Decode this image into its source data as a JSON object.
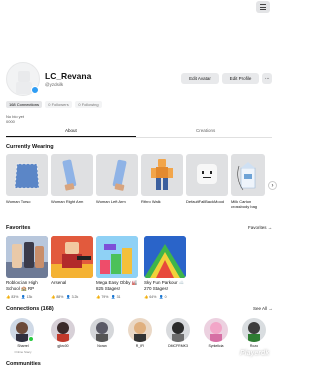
{
  "header": {
    "menu_icon": "hamburger-icon"
  },
  "profile": {
    "display_name": "LC_Revana",
    "username": "@yzdsilk",
    "edit_avatar_label": "Edit Avatar",
    "edit_profile_label": "Edit Profile",
    "more_label": "···",
    "status_color": "#2f9df4"
  },
  "stats": {
    "connections": "168 Connections",
    "followers": "0 Followers",
    "following": "0 Following"
  },
  "bio": {
    "line1": "No bio yet",
    "line2": "0000"
  },
  "tabs": [
    {
      "label": "About"
    },
    {
      "label": "Creations"
    }
  ],
  "currently_wearing": {
    "title": "Currently Wearing",
    "items": [
      {
        "label": "Woman Torso"
      },
      {
        "label": "Woman Right Arm"
      },
      {
        "label": "Woman Left Arm"
      },
      {
        "label": "Rthro Walk"
      },
      {
        "label": "DefaultFallBackMood"
      },
      {
        "label": "Milk Carton\ncrossbody bag"
      }
    ],
    "next_icon": "chevron-right-icon"
  },
  "favorites": {
    "title": "Favorites",
    "link_label": "Favorites →",
    "games": [
      {
        "title": "Roblox:ian High School 🏫 RP",
        "rating": "83%",
        "players": "13k"
      },
      {
        "title": "Arsenal",
        "rating": "88%",
        "players": "3.2k"
      },
      {
        "title": "Mega Easy Obby 🏭 825 Stages!",
        "rating": "79%",
        "players": "31"
      },
      {
        "title": "Sky Fun Parkour ☁️ 270 Stages!",
        "rating": "64%",
        "players": "0"
      }
    ]
  },
  "connections": {
    "title": "Connections (168)",
    "link_label": "See All →",
    "friends": [
      {
        "name": "Sharrel",
        "status": "Online Stacy"
      },
      {
        "name": "gjkrc00"
      },
      {
        "name": "Noran"
      },
      {
        "name": "R_IFI"
      },
      {
        "name": "DMCFRMK3"
      },
      {
        "name": "Syrkelicia"
      },
      {
        "name": "Rozo"
      }
    ]
  },
  "communities": {
    "title": "Communities"
  },
  "watermark": "Playerdk"
}
